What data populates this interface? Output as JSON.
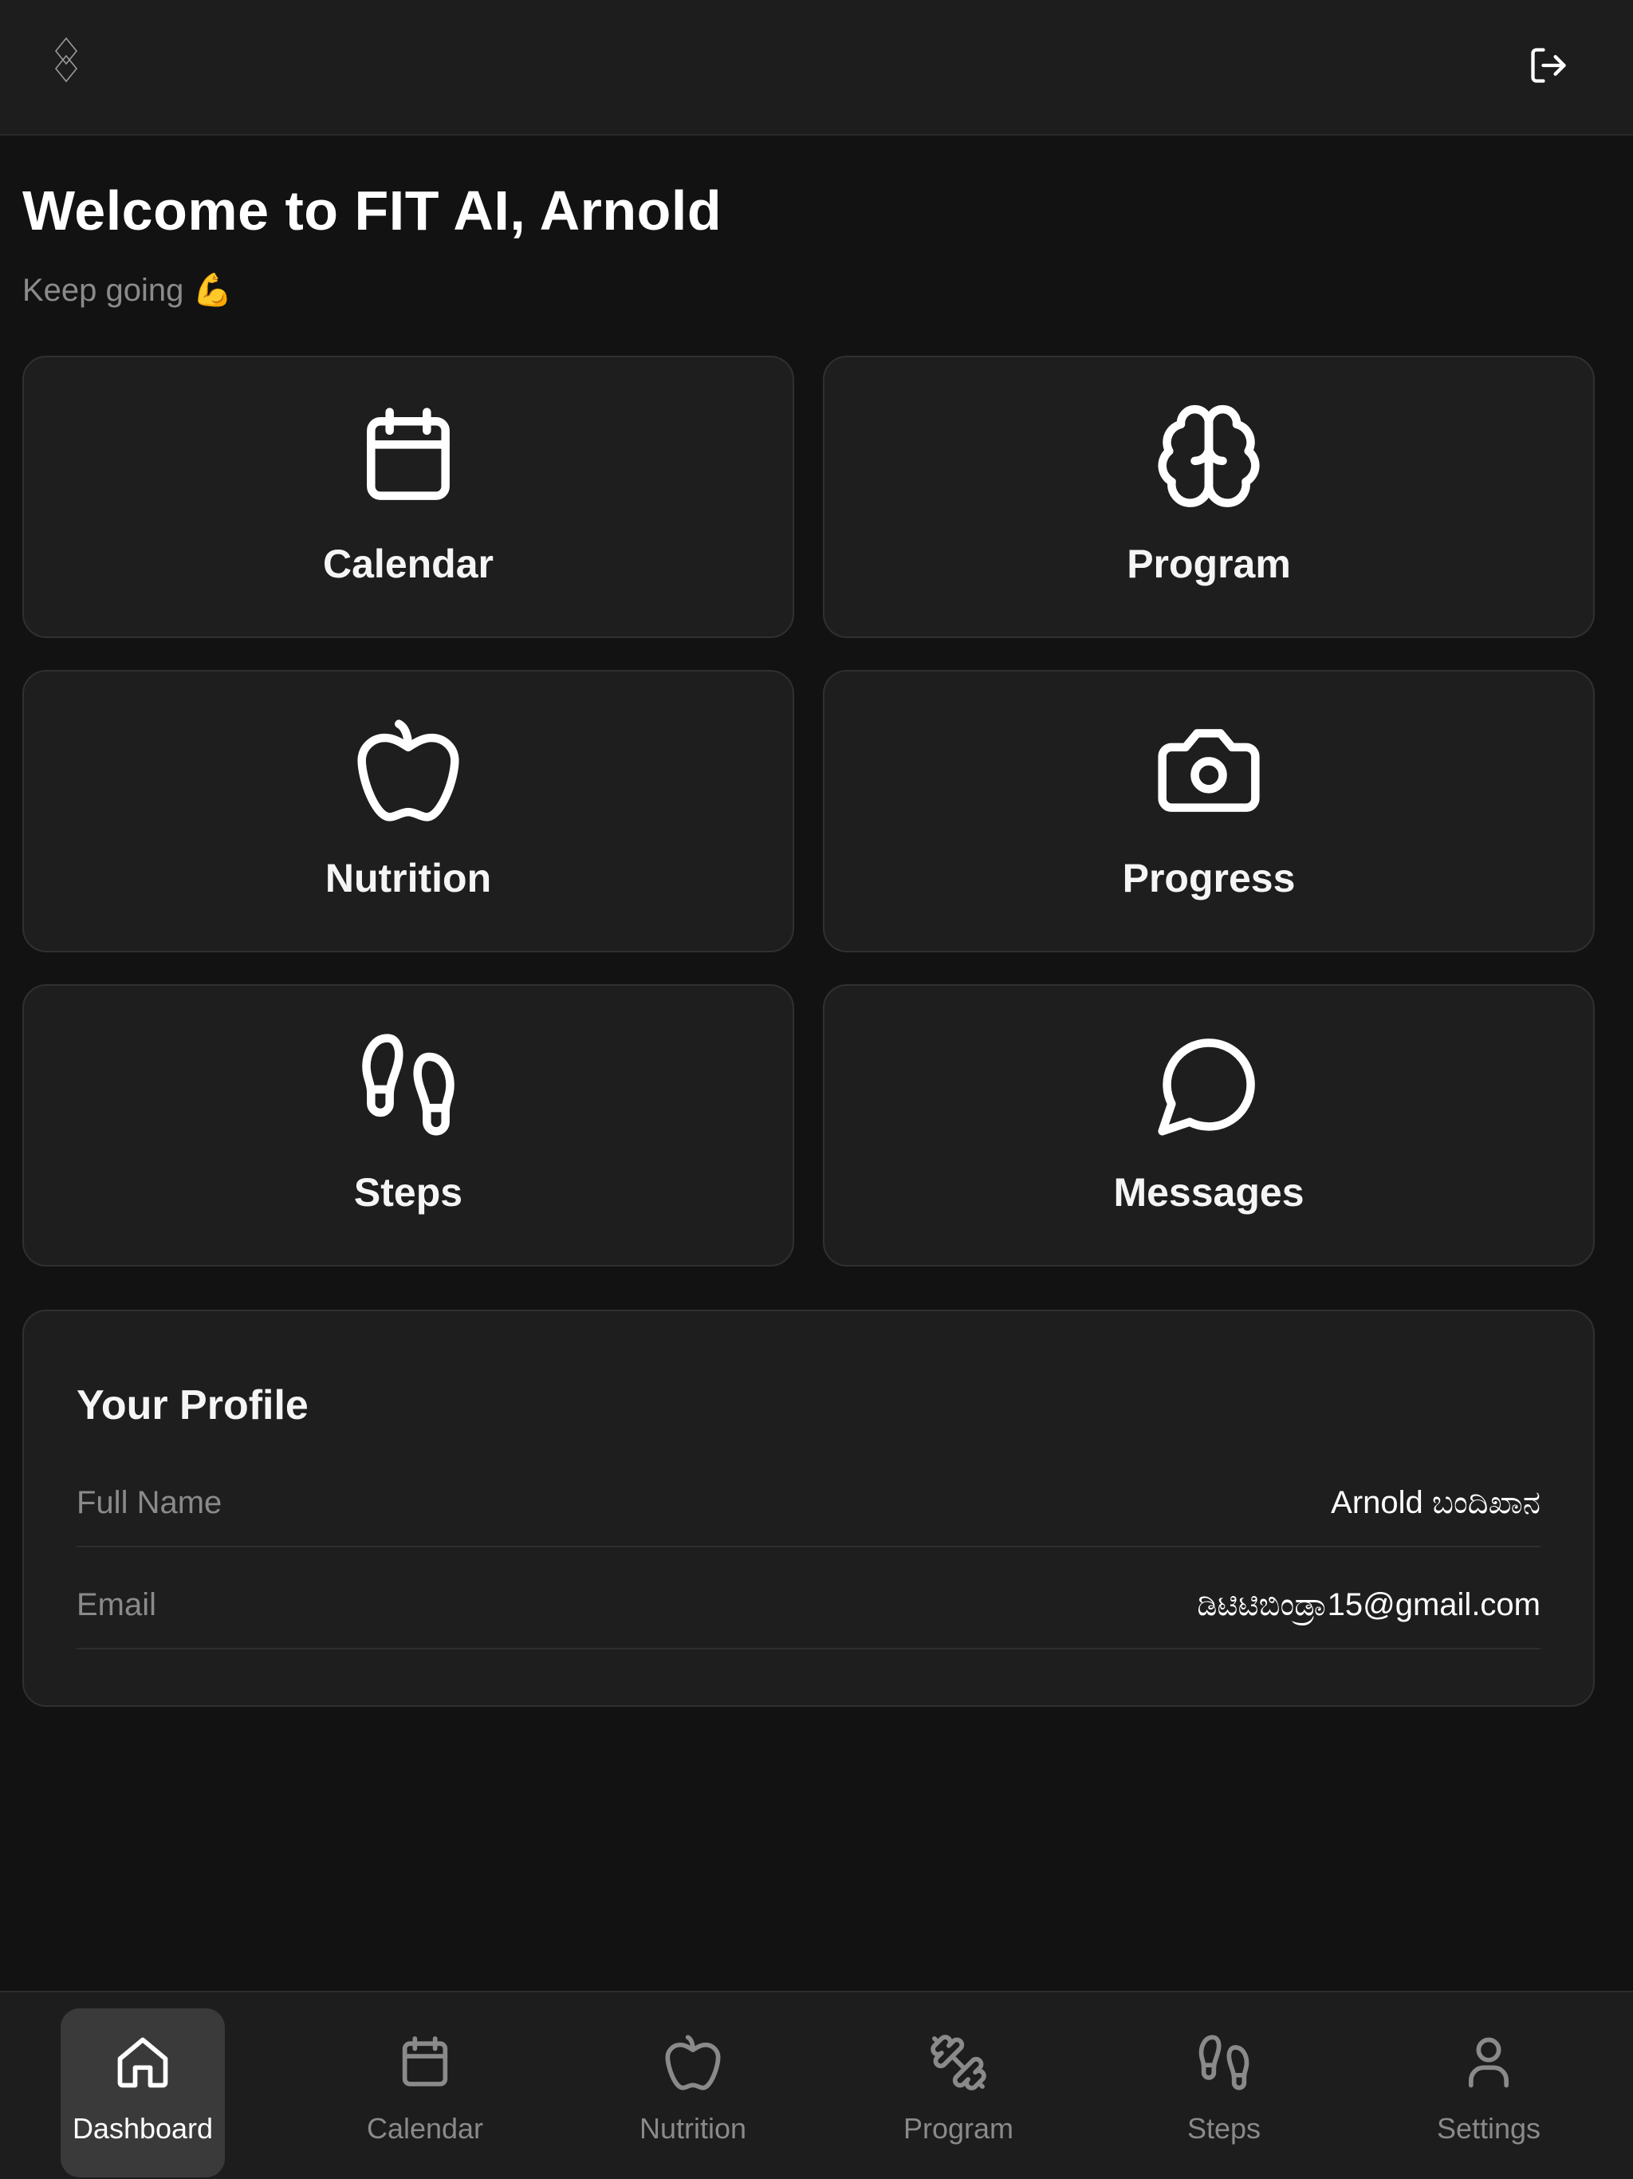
{
  "header": {
    "logo_text": "FITAI",
    "logout_icon": "logout-icon"
  },
  "welcome": {
    "title": "Welcome to FIT AI, Arnold",
    "subtitle": "Keep going",
    "subtitle_emoji": "💪"
  },
  "tiles": [
    {
      "label": "Calendar",
      "icon": "calendar-icon"
    },
    {
      "label": "Program",
      "icon": "brain-icon"
    },
    {
      "label": "Nutrition",
      "icon": "apple-icon"
    },
    {
      "label": "Progress",
      "icon": "camera-icon"
    },
    {
      "label": "Steps",
      "icon": "footprints-icon"
    },
    {
      "label": "Messages",
      "icon": "message-circle-icon"
    }
  ],
  "profile": {
    "title": "Your Profile",
    "rows": [
      {
        "key": "Full Name",
        "value": "Arnold ಬಂದಿಖಾನ"
      },
      {
        "key": "Email",
        "value": "ಡಿಟಿಟಿಬಿಂಡ್ರಾ15@gmail.com"
      }
    ]
  },
  "nav": [
    {
      "label": "Dashboard",
      "icon": "home-icon",
      "active": true
    },
    {
      "label": "Calendar",
      "icon": "calendar-icon",
      "active": false
    },
    {
      "label": "Nutrition",
      "icon": "apple-icon",
      "active": false
    },
    {
      "label": "Program",
      "icon": "dumbbell-icon",
      "active": false
    },
    {
      "label": "Steps",
      "icon": "footprints-icon",
      "active": false
    },
    {
      "label": "Settings",
      "icon": "user-icon",
      "active": false
    }
  ],
  "colors": {
    "background": "#121212",
    "surface": "#1e1e1e",
    "border": "#303030",
    "muted_text": "#8a8a8a",
    "active_nav": "#3a3a3a"
  }
}
